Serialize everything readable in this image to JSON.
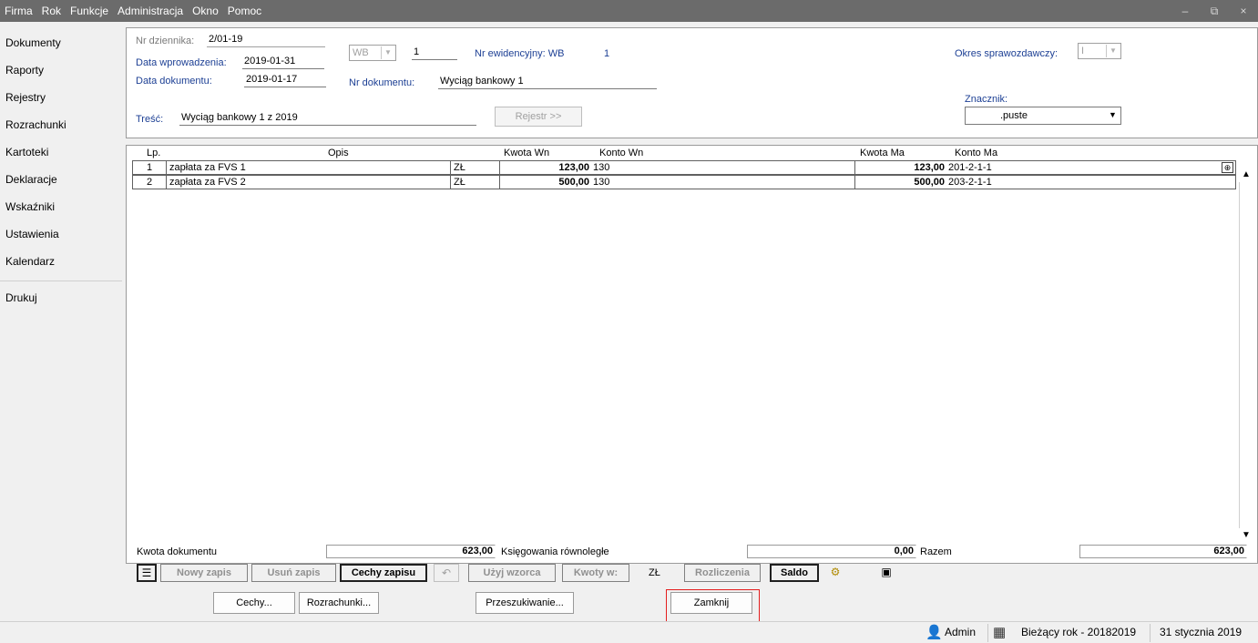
{
  "menu": [
    "Firma",
    "Rok",
    "Funkcje",
    "Administracja",
    "Okno",
    "Pomoc"
  ],
  "window_controls": [
    "–",
    "⧉",
    "×"
  ],
  "sidebar": {
    "items": [
      "Dokumenty",
      "Raporty",
      "Rejestry",
      "Rozrachunki",
      "Kartoteki",
      "Deklaracje",
      "Wskaźniki",
      "Ustawienia",
      "Kalendarz"
    ],
    "extra": "Drukuj"
  },
  "header": {
    "nr_dziennika_label": "Nr dziennika:",
    "nr_dziennika": "2/01-19",
    "data_wprowadzenia_label": "Data wprowadzenia:",
    "data_wprowadzenia": "2019-01-31",
    "data_dokumentu_label": "Data dokumentu:",
    "data_dokumentu": "2019-01-17",
    "typ_combo": "WB",
    "typ_numer": "1",
    "nr_ewidencyjny_label": "Nr ewidencyjny: WB",
    "nr_ewidencyjny": "1",
    "nr_dokumentu_label": "Nr dokumentu:",
    "nr_dokumentu": "Wyciąg bankowy 1",
    "tresc_label": "Treść:",
    "tresc": "Wyciąg bankowy 1 z 2019",
    "rejestr_button": "Rejestr >>",
    "okres_label": "Okres sprawozdawczy:",
    "okres_value": "I",
    "znacznik_label": "Znacznik:",
    "znacznik_value": ".puste"
  },
  "grid": {
    "columns": [
      "Lp.",
      "Opis",
      "Kwota Wn",
      "Konto Wn",
      "Kwota Ma",
      "Konto Ma"
    ],
    "rows": [
      {
        "lp": "1",
        "opis": "zapłata za FVS 1",
        "waluta": "ZŁ",
        "kwota_wn": "123,00",
        "konto_wn": "130",
        "kwota_ma": "123,00",
        "konto_ma": "201-2-1-1"
      },
      {
        "lp": "2",
        "opis": "zapłata za FVS 2",
        "waluta": "ZŁ",
        "kwota_wn": "500,00",
        "konto_wn": "130",
        "kwota_ma": "500,00",
        "konto_ma": "203-2-1-1"
      }
    ]
  },
  "totals": {
    "kwota_dokumentu_label": "Kwota dokumentu",
    "kwota_dokumentu": "623,00",
    "ksiegowania_label": "Księgowania równoległe",
    "ksiegowania": "0,00",
    "razem_label": "Razem",
    "razem": "623,00"
  },
  "toolbar": {
    "nowy_zapis": "Nowy zapis",
    "usun_zapis": "Usuń zapis",
    "cechy_zapisu": "Cechy zapisu",
    "uzyj_wzorca": "Użyj wzorca",
    "kwoty_w": "Kwoty w:",
    "waluta": "ZŁ",
    "rozliczenia": "Rozliczenia",
    "saldo": "Saldo"
  },
  "bottom": {
    "cechy": "Cechy...",
    "rozrachunki": "Rozrachunki...",
    "przeszukiwanie": "Przeszukiwanie...",
    "zamknij": "Zamknij"
  },
  "status": {
    "user": "Admin",
    "rok": "Bieżący rok - 20182019",
    "data": "31 stycznia 2019"
  }
}
